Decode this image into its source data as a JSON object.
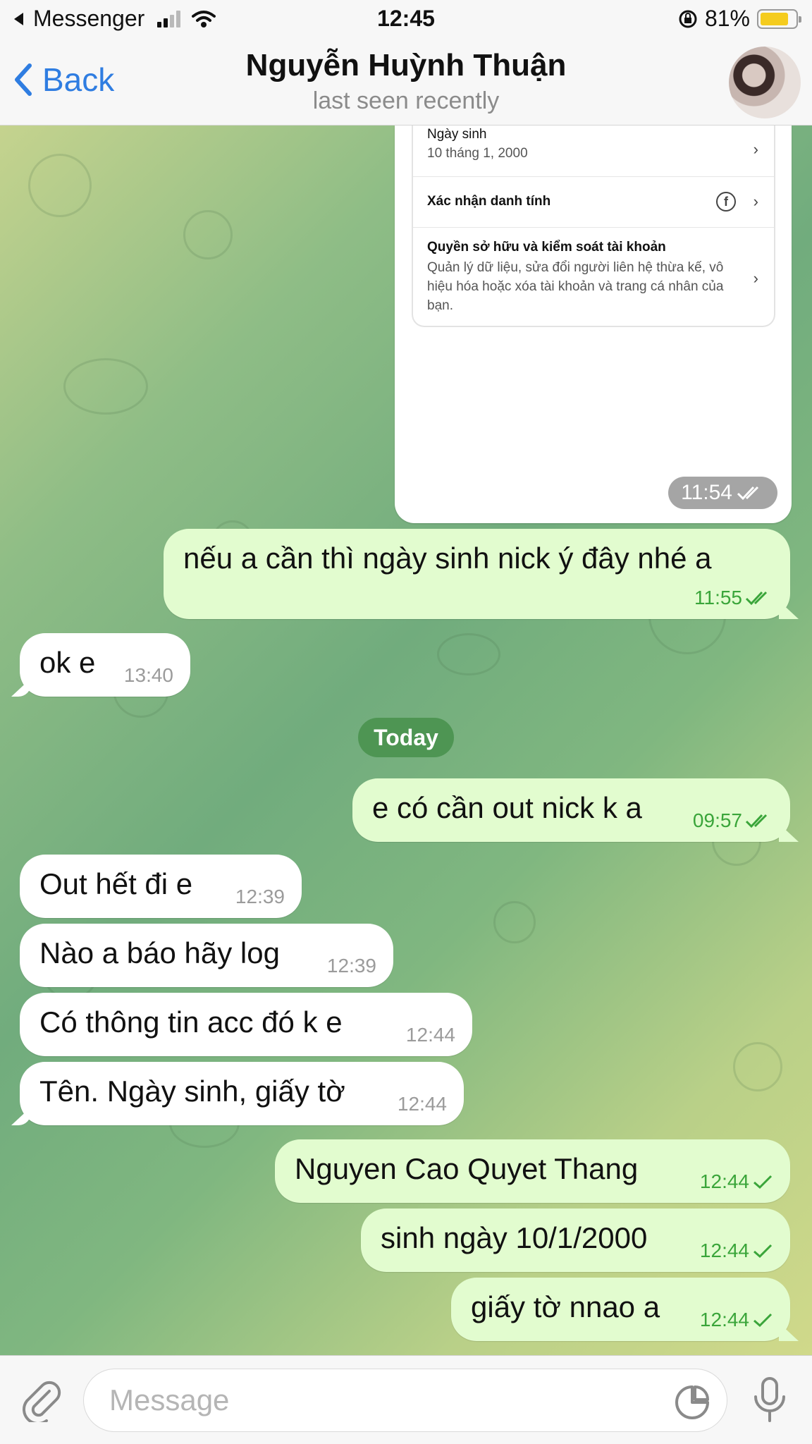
{
  "status_bar": {
    "back_app": "Messenger",
    "time": "12:45",
    "battery": "81%"
  },
  "header": {
    "back_label": "Back",
    "title": "Nguyễn Huỳnh Thuận",
    "subtitle": "last seen recently"
  },
  "shared_screenshot": {
    "rows": [
      {
        "label": "Ngày sinh",
        "sub": "10 tháng 1, 2000"
      },
      {
        "label": "Xác nhận danh tính",
        "sub": ""
      },
      {
        "label": "Quyền sở hữu và kiểm soát tài khoản",
        "sub": "Quản lý dữ liệu, sửa đổi người liên hệ thừa kế, vô hiệu hóa hoặc xóa tài khoản và trang cá nhân của bạn."
      }
    ],
    "time": "11:54"
  },
  "messages": [
    {
      "text": "nếu a cần thì ngày sinh nick ý đây nhé a",
      "time": "11:55"
    },
    {
      "text": "ok e",
      "time": "13:40"
    },
    {
      "text": "e có cần out nick k a",
      "time": "09:57"
    },
    {
      "text": "Out hết đi e",
      "time": "12:39"
    },
    {
      "text": "Nào a báo hãy log",
      "time": "12:39"
    },
    {
      "text": "Có thông tin acc đó k e",
      "time": "12:44"
    },
    {
      "text": "Tên. Ngày sinh, giấy tờ",
      "time": "12:44"
    },
    {
      "text": "Nguyen Cao Quyet Thang",
      "time": "12:44"
    },
    {
      "text": "sinh ngày 10/1/2000",
      "time": "12:44"
    },
    {
      "text": "giấy tờ nnao a",
      "time": "12:44"
    }
  ],
  "date_separator": "Today",
  "input": {
    "placeholder": "Message"
  },
  "colors": {
    "outgoing_bubble": "#e2fccf",
    "incoming_bubble": "#ffffff",
    "accent": "#2f7de1",
    "read_check": "#3aa53a"
  }
}
